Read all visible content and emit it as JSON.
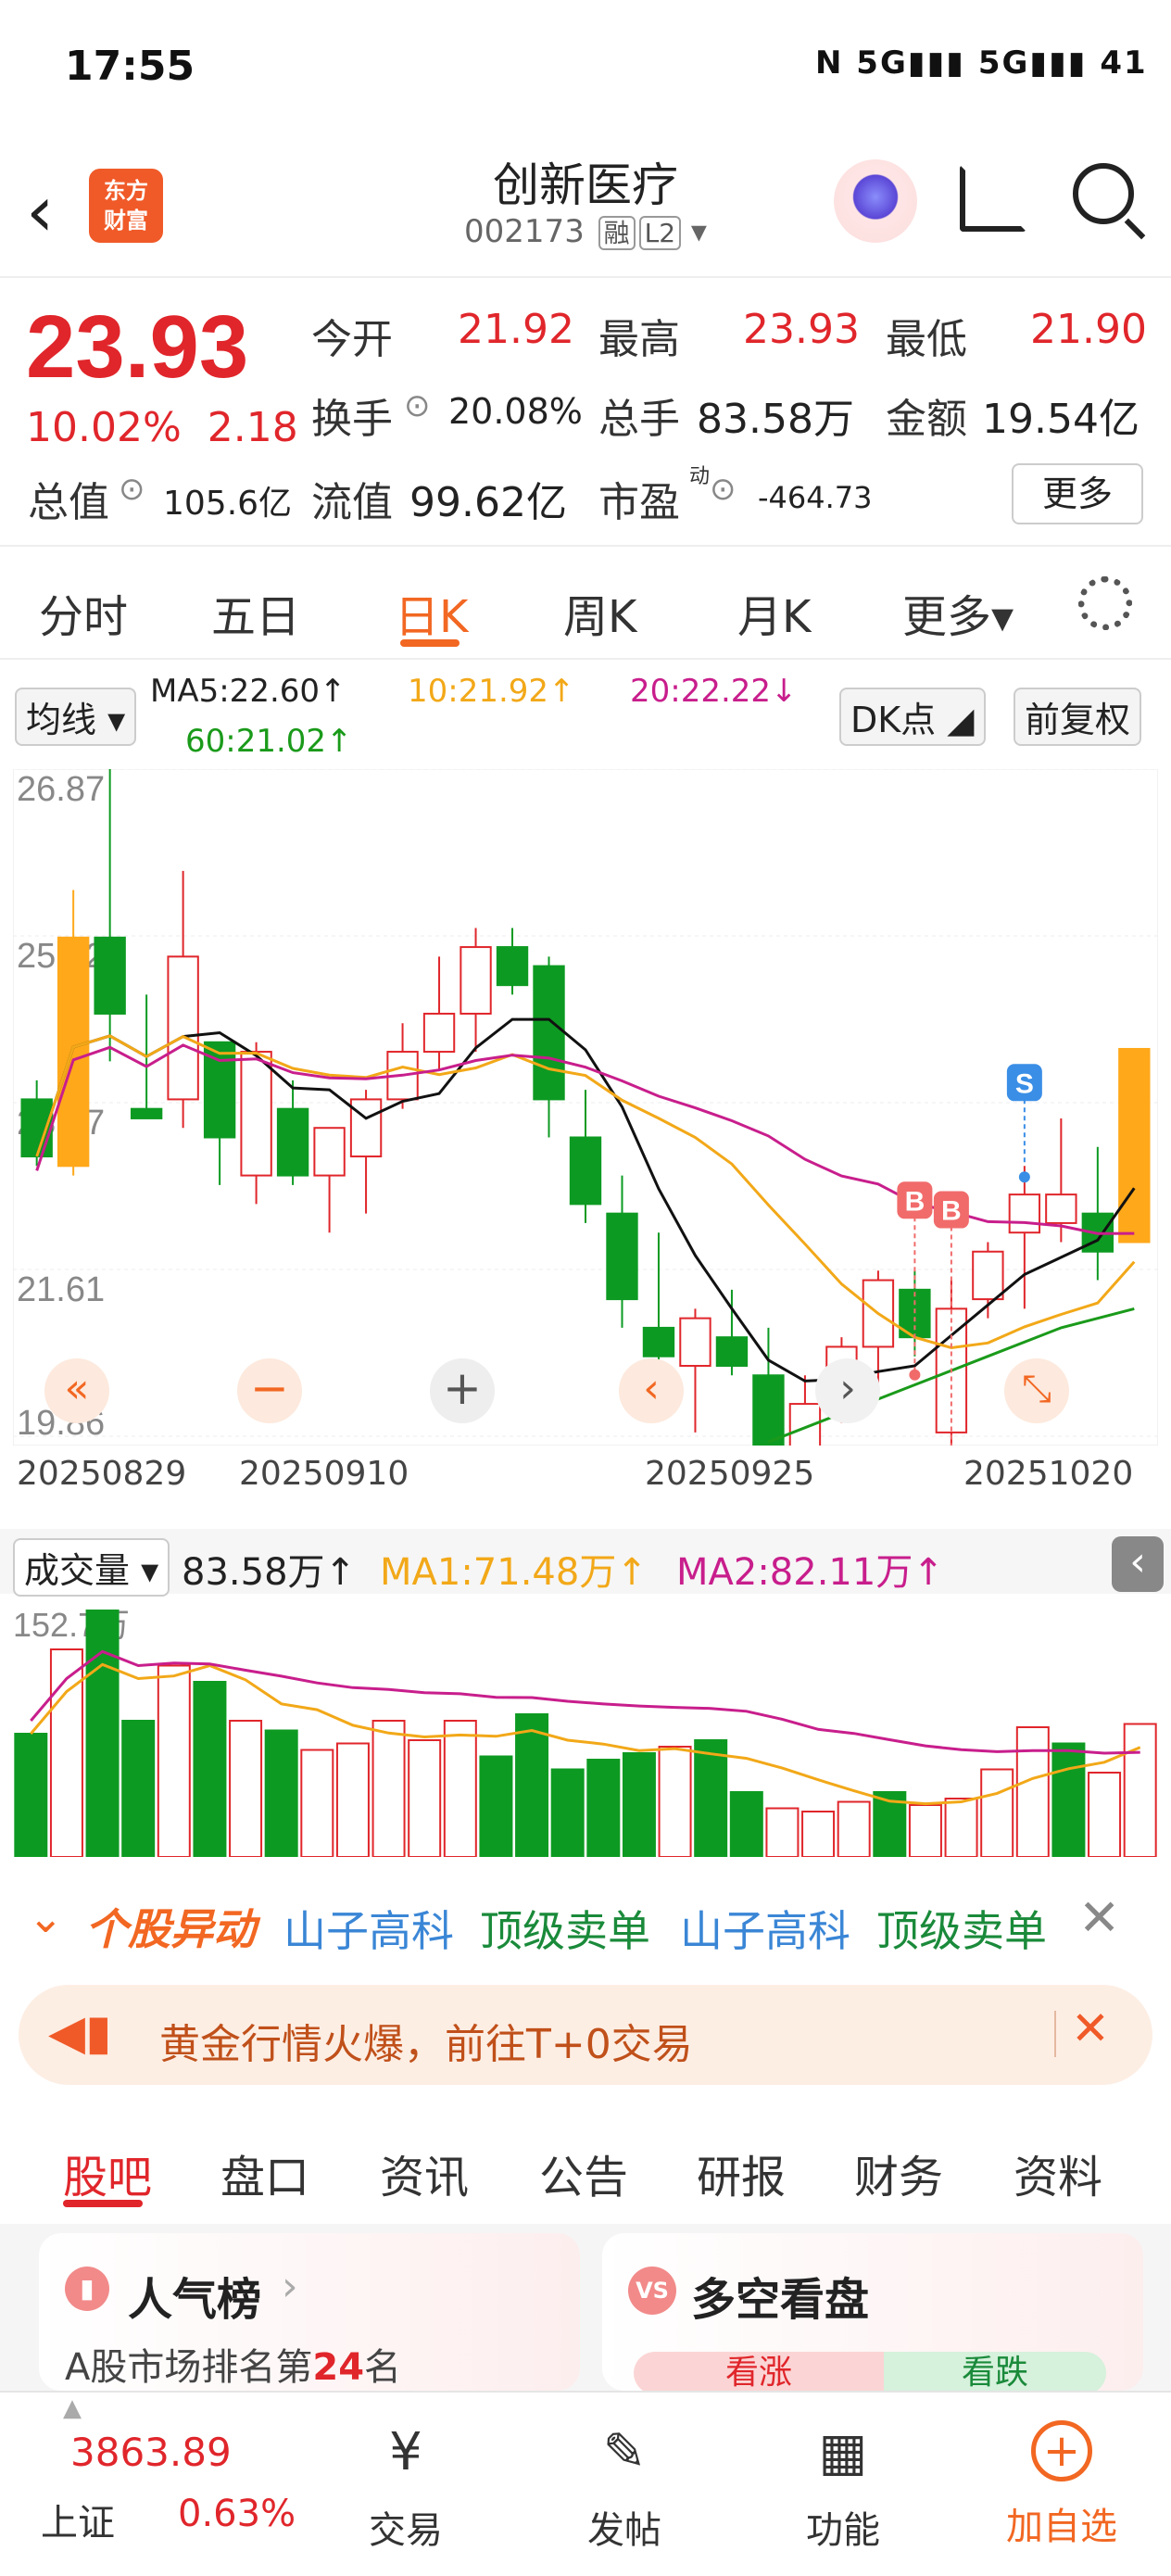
{
  "status": {
    "time": "17:55",
    "icons": "N  5G▮▮▮ 5G▮▮▮ 41"
  },
  "header": {
    "logo_line1": "东方",
    "logo_line2": "财富",
    "title": "创新医疗",
    "code": "002173",
    "tag1": "融",
    "tag2": "L2"
  },
  "quote": {
    "price": "23.93",
    "change_pct": "10.02%",
    "change": "2.18",
    "open_label": "今开",
    "open": "21.92",
    "high_label": "最高",
    "high": "23.93",
    "low_label": "最低",
    "low": "21.90",
    "turnover_label": "换手",
    "turnover": "20.08%",
    "volume_label": "总手",
    "volume": "83.58万",
    "amount_label": "金额",
    "amount": "19.54亿",
    "mcap_label": "总值",
    "mcap": "105.6亿",
    "float_label": "流值",
    "float": "99.62亿",
    "pe_label": "市盈",
    "pe_sup": "动",
    "pe": "-464.73",
    "more": "更多"
  },
  "tabs": [
    "分时",
    "五日",
    "日K",
    "周K",
    "月K",
    "更多▾"
  ],
  "ma": {
    "btn": "均线",
    "ma5": "MA5:22.60↑",
    "ma10": "10:21.92↑",
    "ma20": "20:22.22↓",
    "ma60": "60:21.02↑",
    "dk": "DK点",
    "fq": "前复权"
  },
  "chart_data": {
    "type": "candlestick",
    "y_ticks": [
      "26.87",
      "25.12",
      "23.37",
      "21.61",
      "19.86"
    ],
    "ylim": [
      19.86,
      26.87
    ],
    "x_ticks": [
      "20250829",
      "20250910",
      "20250925",
      "20251020"
    ],
    "candles": [
      {
        "o": 23.4,
        "h": 23.6,
        "l": 22.7,
        "c": 22.8
      },
      {
        "o": 22.7,
        "h": 25.6,
        "l": 22.6,
        "c": 25.1
      },
      {
        "o": 25.1,
        "h": 27.0,
        "l": 23.8,
        "c": 24.3
      },
      {
        "o": 23.3,
        "h": 24.5,
        "l": 23.2,
        "c": 23.2
      },
      {
        "o": 23.4,
        "h": 25.8,
        "l": 23.1,
        "c": 24.9
      },
      {
        "o": 24.0,
        "h": 24.0,
        "l": 22.5,
        "c": 23.0
      },
      {
        "o": 22.6,
        "h": 24.0,
        "l": 22.3,
        "c": 23.9
      },
      {
        "o": 23.3,
        "h": 23.6,
        "l": 22.5,
        "c": 22.6
      },
      {
        "o": 22.6,
        "h": 23.1,
        "l": 22.0,
        "c": 23.1
      },
      {
        "o": 22.8,
        "h": 23.5,
        "l": 22.2,
        "c": 23.4
      },
      {
        "o": 23.4,
        "h": 24.2,
        "l": 23.3,
        "c": 23.9
      },
      {
        "o": 23.9,
        "h": 24.9,
        "l": 23.7,
        "c": 24.3
      },
      {
        "o": 24.3,
        "h": 25.2,
        "l": 23.9,
        "c": 25.0
      },
      {
        "o": 25.0,
        "h": 25.2,
        "l": 24.5,
        "c": 24.6
      },
      {
        "o": 24.8,
        "h": 24.9,
        "l": 23.0,
        "c": 23.4
      },
      {
        "o": 23.0,
        "h": 23.5,
        "l": 22.1,
        "c": 22.3
      },
      {
        "o": 22.2,
        "h": 22.6,
        "l": 21.0,
        "c": 21.3
      },
      {
        "o": 21.0,
        "h": 22.0,
        "l": 20.3,
        "c": 20.7
      },
      {
        "o": 20.6,
        "h": 21.2,
        "l": 19.9,
        "c": 21.1
      },
      {
        "o": 20.9,
        "h": 21.4,
        "l": 20.5,
        "c": 20.6
      },
      {
        "o": 20.5,
        "h": 21.0,
        "l": 19.5,
        "c": 19.6
      },
      {
        "o": 19.7,
        "h": 20.5,
        "l": 19.6,
        "c": 20.2
      },
      {
        "o": 20.1,
        "h": 20.9,
        "l": 20.0,
        "c": 20.8
      },
      {
        "o": 20.8,
        "h": 21.6,
        "l": 20.4,
        "c": 21.5
      },
      {
        "o": 21.4,
        "h": 21.6,
        "l": 20.7,
        "c": 20.9
      },
      {
        "o": 19.9,
        "h": 21.5,
        "l": 19.7,
        "c": 21.2
      },
      {
        "o": 21.3,
        "h": 21.9,
        "l": 21.1,
        "c": 21.8
      },
      {
        "o": 22.0,
        "h": 22.7,
        "l": 21.2,
        "c": 22.4
      },
      {
        "o": 22.1,
        "h": 23.2,
        "l": 21.9,
        "c": 22.4
      },
      {
        "o": 22.2,
        "h": 22.9,
        "l": 21.5,
        "c": 21.8
      },
      {
        "o": 21.9,
        "h": 23.9,
        "l": 21.9,
        "c": 23.93
      }
    ],
    "markers": [
      {
        "idx": 24,
        "label": "B"
      },
      {
        "idx": 25,
        "label": "B"
      },
      {
        "idx": 27,
        "label": "S"
      }
    ],
    "volume": {
      "label": "成交量",
      "value": "83.58万↑",
      "ma1": "MA1:71.48万↑",
      "ma2": "MA2:82.11万↑",
      "max_tick": "152.7万",
      "values": [
        76,
        128,
        152,
        84,
        118,
        108,
        84,
        78,
        66,
        70,
        84,
        72,
        84,
        62,
        88,
        54,
        60,
        64,
        68,
        72,
        40,
        30,
        28,
        34,
        40,
        32,
        36,
        54,
        80,
        70,
        52,
        82
      ]
    }
  },
  "alert": {
    "icon_text": "个股异动",
    "items": [
      "山子高科",
      "顶级卖单",
      "山子高科",
      "顶级卖单"
    ]
  },
  "banner": {
    "text": "黄金行情火爆，前往T+0交易"
  },
  "stocktabs": [
    "股吧",
    "盘口",
    "资讯",
    "公告",
    "研报",
    "财务",
    "资料"
  ],
  "cards": {
    "left_title": "人气榜",
    "left_sub": "A股市场排名第",
    "left_rank": "24",
    "left_sub2": "名",
    "right_title": "多空看盘",
    "rise": "看涨",
    "fall": "看跌"
  },
  "bottom": {
    "index_value": "3863.89",
    "index_name": "上证",
    "index_pct": "0.63%",
    "trade": "交易",
    "post": "发帖",
    "func": "功能",
    "add": "加自选"
  }
}
